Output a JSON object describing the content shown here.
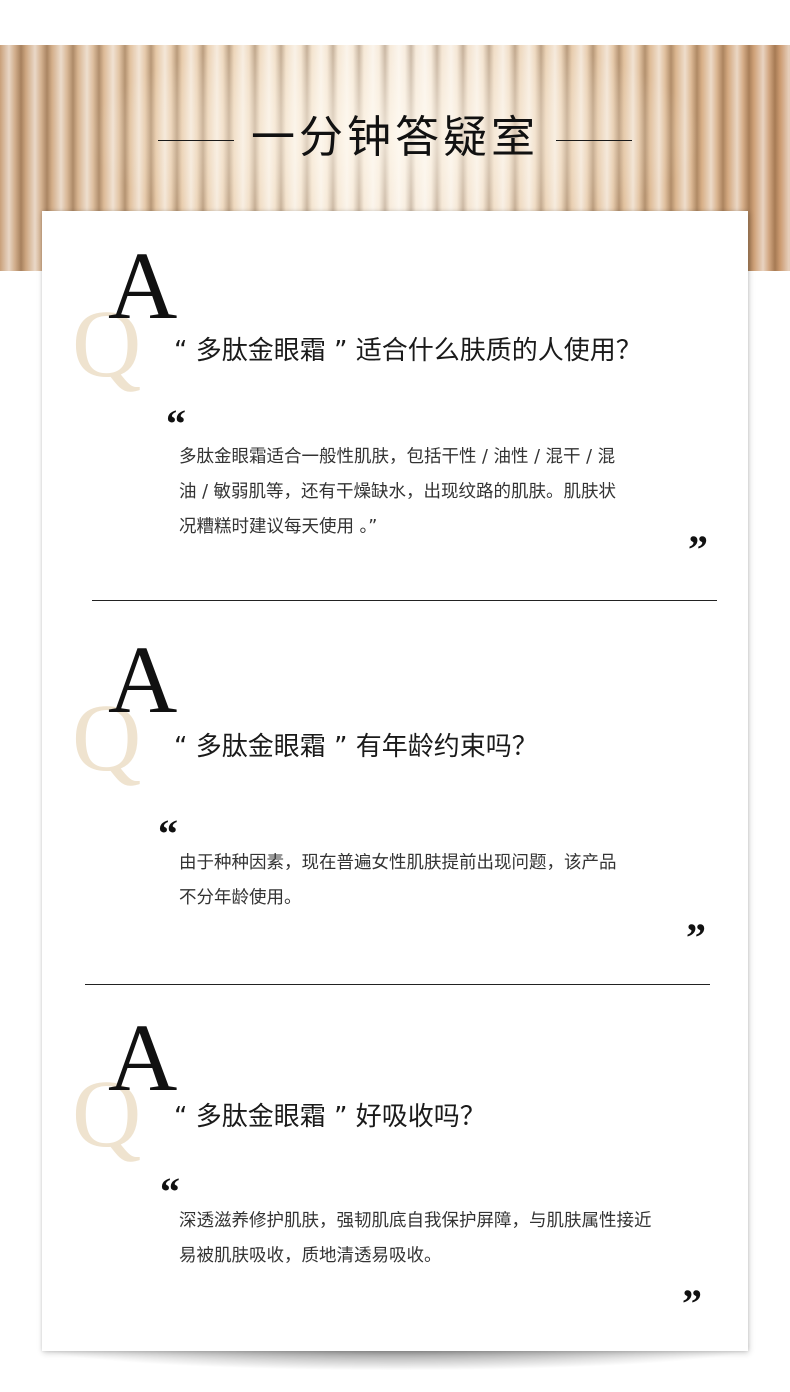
{
  "page": {
    "title": "一分钟答疑室",
    "q_letter": "Q",
    "a_letter": "A",
    "open_quote": "“",
    "close_quote": "”"
  },
  "faq": [
    {
      "question": "“ 多肽金眼霜 ” 适合什么肤质的人使用？",
      "answer_lines": [
        "多肽金眼霜适合一般性肌肤，包括干性 / 油性 / 混干 / 混",
        "油 / 敏弱肌等，还有干燥缺水，出现纹路的肌肤。肌肤状",
        "况糟糕时建议每天使用 。”"
      ]
    },
    {
      "question": "“ 多肽金眼霜 ” 有年龄约束吗？",
      "answer_lines": [
        "由于种种因素，现在普遍女性肌肤提前出现问题，该产品",
        "不分年龄使用。"
      ]
    },
    {
      "question": "“ 多肽金眼霜 ” 好吸收吗？",
      "answer_lines": [
        "深透滋养修护肌肤，强韧肌底自我保护屏障，与肌肤属性接近",
        "易被肌肤吸收，质地清透易吸收。"
      ]
    }
  ],
  "colors": {
    "q_letter": "#efe3cf",
    "text": "#1a1a1a",
    "banner": "#e6c8a6"
  }
}
